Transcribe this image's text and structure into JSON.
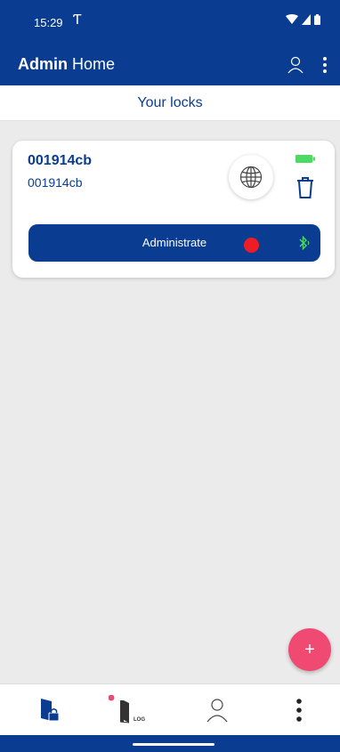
{
  "status_bar": {
    "time": "15:29",
    "carrier_glyph": "Ƭ"
  },
  "app_bar": {
    "role": "Admin",
    "page": "Home"
  },
  "subheader": {
    "title": "Your locks"
  },
  "lock_card": {
    "name": "001914cb",
    "id": "001914cb",
    "battery_color": "#4cd964",
    "button_label": "Administrate",
    "status_dot_color": "#ee1c24",
    "bluetooth_color": "#4cd964"
  },
  "fab": {
    "label": "+",
    "color": "#f04a72"
  },
  "bottom_nav": {
    "log_label": "LOG"
  },
  "theme": {
    "primary": "#0a3d91",
    "background": "#ebebeb"
  }
}
